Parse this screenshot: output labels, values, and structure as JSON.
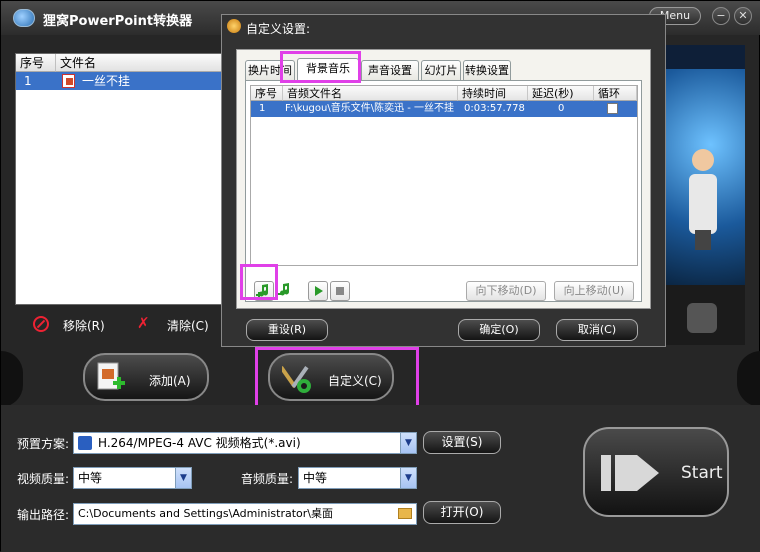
{
  "app": {
    "title": "狸窝PowerPoint转换器",
    "menu_label": "Menu",
    "minimize_label": "−",
    "close_label": "✕"
  },
  "file_list": {
    "columns": [
      "序号",
      "文件名"
    ],
    "rows": [
      {
        "index": "1",
        "name": "一丝不挂"
      }
    ]
  },
  "actions": {
    "remove_label": "移除(R)",
    "clear_label": "清除(C)",
    "add_label": "添加(A)",
    "custom_label": "自定义(C)"
  },
  "settings": {
    "preset_label": "预置方案:",
    "preset_value": "H.264/MPEG-4 AVC 视频格式(*.avi)",
    "preset_button": "设置(S)",
    "video_quality_label": "视频质量:",
    "video_quality_value": "中等",
    "audio_quality_label": "音频质量:",
    "audio_quality_value": "中等",
    "output_label": "输出路径:",
    "output_value": "C:\\Documents and Settings\\Administrator\\桌面",
    "open_button": "打开(O)",
    "start_label": "Start"
  },
  "dialog": {
    "title": "自定义设置:",
    "tabs": [
      "换片时间",
      "背景音乐",
      "声音设置",
      "幻灯片",
      "转换设置"
    ],
    "active_tab": "背景音乐",
    "table_columns": [
      "序号",
      "音频文件名",
      "持续时间",
      "延迟(秒)",
      "循环"
    ],
    "table_rows": [
      {
        "index": "1",
        "file": "F:\\kugou\\音乐文件\\陈奕迅 - 一丝不挂.",
        "duration": "0:03:57.778",
        "delay": "0",
        "loop": false
      }
    ],
    "move_down_label": "向下移动(D)",
    "move_up_label": "向上移动(U)",
    "reset_label": "重设(R)",
    "ok_label": "确定(O)",
    "cancel_label": "取消(C)"
  },
  "colors": {
    "highlight": "#e040e8",
    "selection": "#3a72c8"
  }
}
